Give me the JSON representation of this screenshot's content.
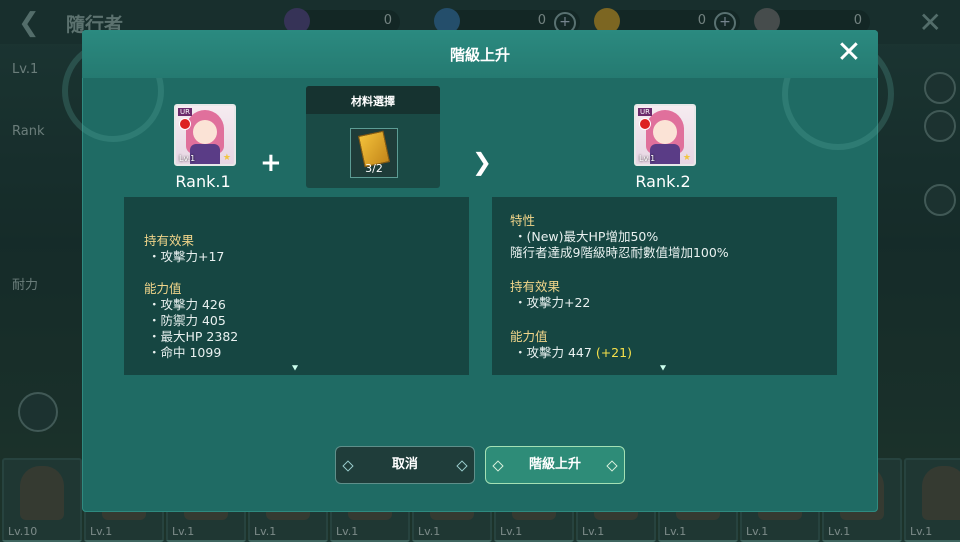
{
  "background": {
    "title": "隨行者",
    "resources": [
      "0",
      "0",
      "0",
      "0"
    ],
    "left_labels": {
      "level": "Lv.1",
      "rank": "Rank",
      "stamina": "耐力"
    },
    "card_levels": [
      "Lv.10",
      "Lv.1",
      "Lv.1",
      "Lv.1",
      "Lv.1",
      "Lv.1",
      "Lv.1",
      "Lv.1",
      "Lv.1",
      "Lv.1",
      "Lv.1",
      "Lv.1"
    ]
  },
  "dialog": {
    "title": "階級上升",
    "current": {
      "rank_label": "Rank.1",
      "portrait": {
        "grade": "UR",
        "level": "Lv.1"
      }
    },
    "next": {
      "rank_label": "Rank.2",
      "portrait": {
        "grade": "UR",
        "level": "Lv.1"
      }
    },
    "material": {
      "title": "材料選擇",
      "count": "3/2",
      "icon": "skill-book-icon"
    },
    "left_panel": {
      "sections": [
        {
          "head": "持有效果",
          "rows": [
            "・攻擊力+17"
          ]
        },
        {
          "head": "能力值",
          "rows": [
            "・攻擊力 426",
            "・防禦力 405",
            "・最大HP 2382",
            "・命中 1099"
          ]
        }
      ]
    },
    "right_panel": {
      "trait_head": "特性",
      "trait_rows": [
        "・(New)最大HP增加50%",
        "隨行者達成9階級時忍耐數值增加100%"
      ],
      "holding_head": "持有效果",
      "holding_rows": [
        "・攻擊力+22"
      ],
      "stats_head": "能力值",
      "stats_row": {
        "label": "・攻擊力 447",
        "bonus": "(+21)"
      }
    },
    "buttons": {
      "cancel": "取消",
      "confirm": "階級上升"
    }
  },
  "colors": {
    "dialog_bg": "#1f6b64",
    "header": "#2b8a80",
    "section_head": "#f1d58a",
    "bonus": "#f6e04a",
    "confirm": "#2e8c78"
  }
}
